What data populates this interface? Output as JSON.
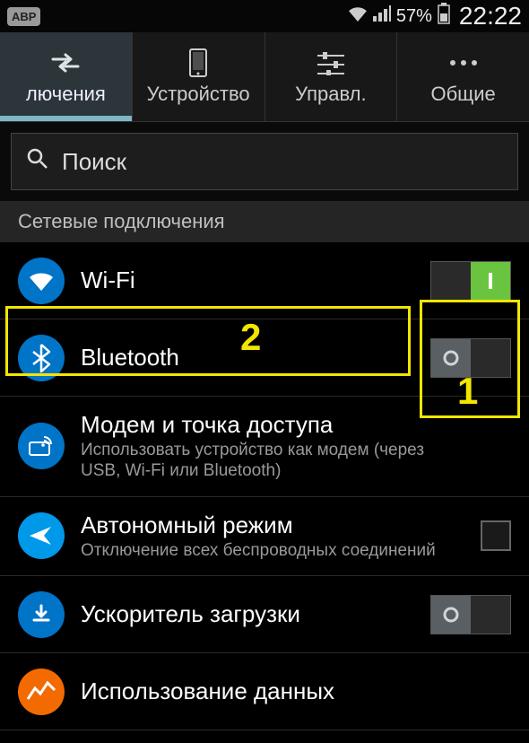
{
  "status": {
    "abp": "ABP",
    "battery_pct": "57%",
    "time": "22:22"
  },
  "tabs": {
    "connections": "лючения",
    "device": "Устройство",
    "controls": "Управл.",
    "general": "Общие"
  },
  "search": {
    "placeholder": "Поиск"
  },
  "section": {
    "network": "Сетевые подключения"
  },
  "rows": {
    "wifi": {
      "title": "Wi-Fi"
    },
    "bluetooth": {
      "title": "Bluetooth"
    },
    "tether": {
      "title": "Модем и точка доступа",
      "sub": "Использовать устройство как модем (через USB, Wi-Fi или Bluetooth)"
    },
    "airplane": {
      "title": "Автономный режим",
      "sub": "Отключение всех беспроводных соединений"
    },
    "booster": {
      "title": "Ускоритель загрузки"
    },
    "data": {
      "title": "Использование данных"
    }
  },
  "annotations": {
    "label1": "1",
    "label2": "2"
  }
}
